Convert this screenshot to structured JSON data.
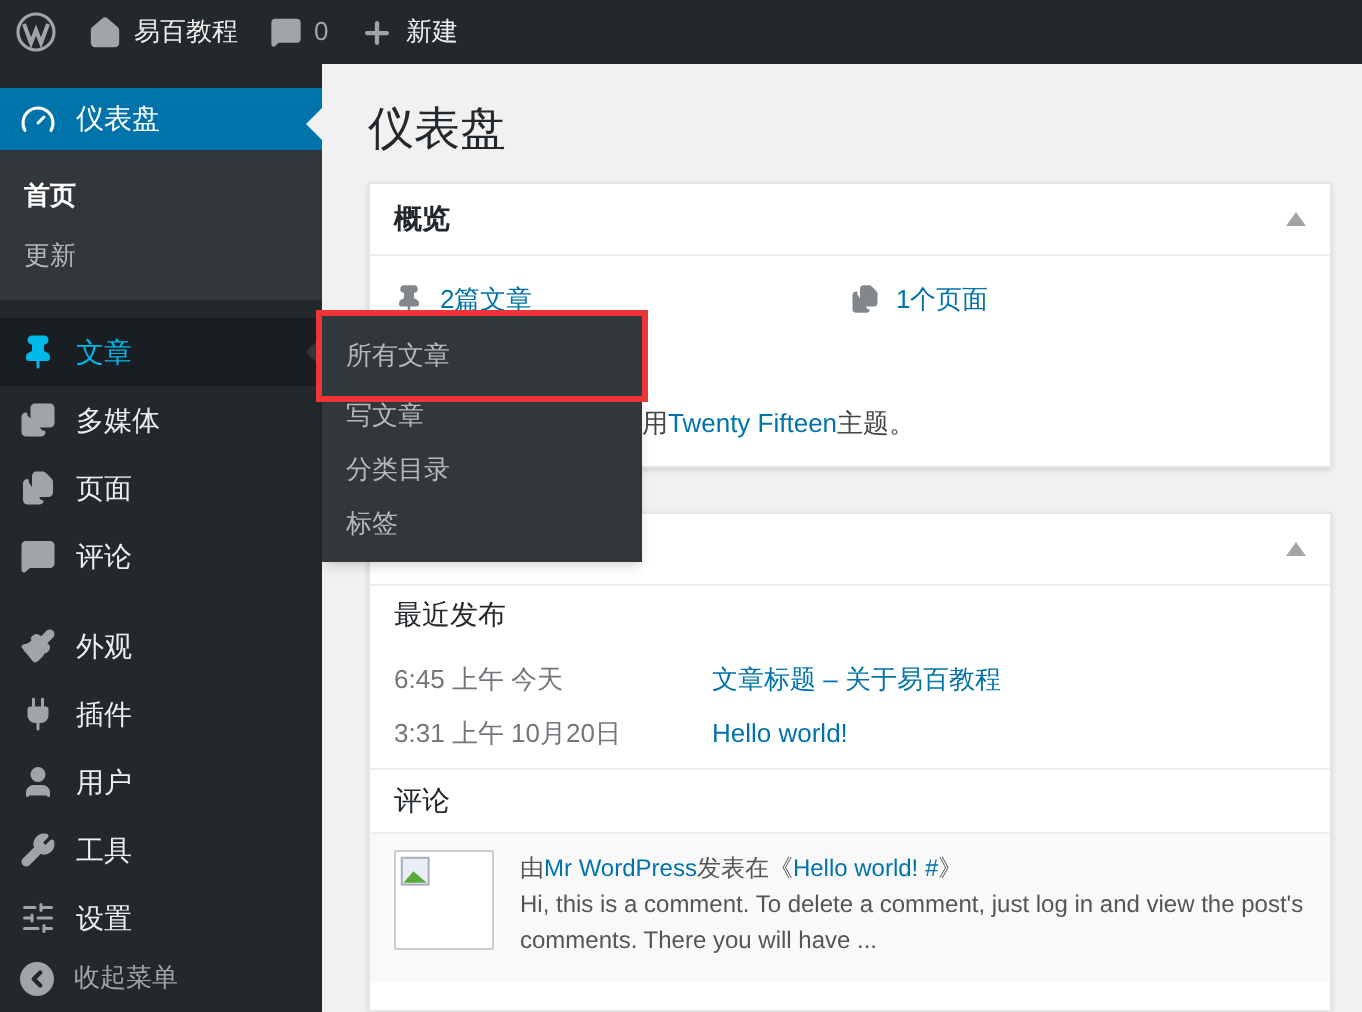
{
  "toolbar": {
    "site_name": "易百教程",
    "comments_count": "0",
    "new_label": "新建"
  },
  "sidebar": {
    "current": {
      "label": "仪表盘",
      "selected": true,
      "submenu": [
        {
          "label": "首页",
          "selected": true
        },
        {
          "label": "更新",
          "selected": false
        }
      ]
    },
    "groups": [
      [
        {
          "label": "文章",
          "open": true
        },
        {
          "label": "多媒体",
          "open": false
        },
        {
          "label": "页面",
          "open": false
        },
        {
          "label": "评论",
          "open": false
        }
      ],
      [
        {
          "label": "外观",
          "open": false
        },
        {
          "label": "插件",
          "open": false
        },
        {
          "label": "用户",
          "open": false
        },
        {
          "label": "工具",
          "open": false
        },
        {
          "label": "设置",
          "open": false
        }
      ]
    ],
    "collapse_label": "收起菜单"
  },
  "flyout": {
    "items": [
      {
        "label": "所有文章",
        "highlighted": true
      },
      {
        "label": "写文章",
        "highlighted": false
      },
      {
        "label": "分类目录",
        "highlighted": false
      },
      {
        "label": "标签",
        "highlighted": false
      }
    ]
  },
  "page_title": "仪表盘",
  "overview": {
    "title": "概览",
    "expanded": true,
    "stats": [
      {
        "text": "2篇文章"
      },
      {
        "text": "1个页面"
      }
    ],
    "theme_line": {
      "before": "用",
      "link": "Twenty Fifteen",
      "after": "主题。"
    }
  },
  "activity": {
    "expanded": true,
    "recent_heading": "最近发布",
    "posts": [
      {
        "time": "6:45 上午 今天",
        "title": "文章标题 – 关于易百教程"
      },
      {
        "time": "3:31 上午 10月20日",
        "title": "Hello world!"
      }
    ],
    "comments_heading": "评论",
    "comments": [
      {
        "by": "由",
        "author": "Mr WordPress",
        "posted_in": "发表在《",
        "post": "Hello world! #",
        "close": "》",
        "excerpt": "Hi, this is a comment. To delete a comment, just log in and view the post's comments. There you will have ..."
      }
    ]
  }
}
